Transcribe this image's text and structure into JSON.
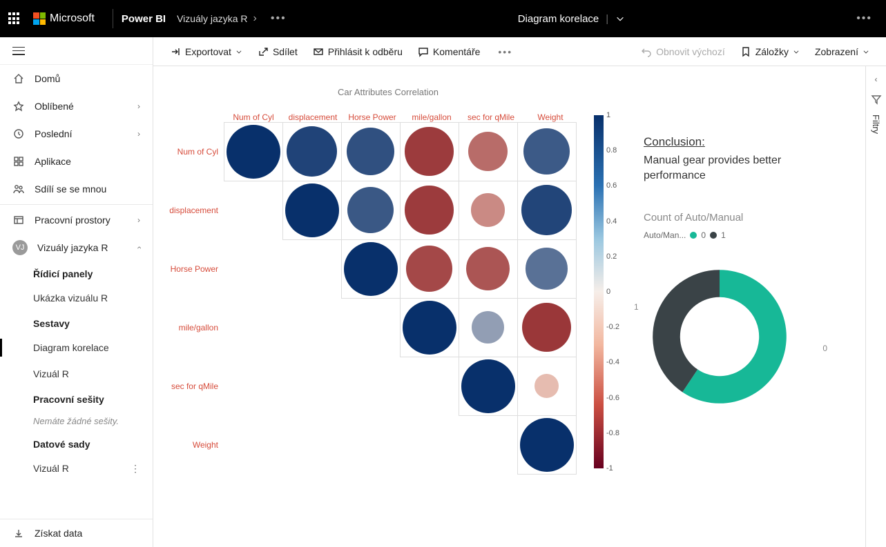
{
  "header": {
    "brand": "Microsoft",
    "app": "Power BI",
    "breadcrumb": "Vizuály jazyka R",
    "page_title": "Diagram korelace"
  },
  "nav": {
    "home": "Domů",
    "favorites": "Oblíbené",
    "recent": "Poslední",
    "apps": "Aplikace",
    "shared": "Sdílí se se mnou",
    "workspaces": "Pracovní prostory",
    "current_ws": "Vizuály jazyka R",
    "ws_initials": "VJ",
    "sections": {
      "dashboards": "Řídicí panely",
      "dash_item1": "Ukázka vizuálu R",
      "reports": "Sestavy",
      "rep_item1": "Diagram korelace",
      "rep_item2": "Vizuál R",
      "workbooks": "Pracovní sešity",
      "workbooks_empty": "Nemáte žádné sešity.",
      "datasets": "Datové sady",
      "ds_item1": "Vizuál R"
    },
    "get_data": "Získat data"
  },
  "toolbar": {
    "export": "Exportovat",
    "share": "Sdílet",
    "subscribe": "Přihlásit k odběru",
    "comments": "Komentáře",
    "reset": "Obnovit výchozí",
    "bookmarks": "Záložky",
    "view": "Zobrazení"
  },
  "filters_rail": "Filtry",
  "report": {
    "chart_title": "Car Attributes Correlation",
    "conclusion_head": "Conclusion:",
    "conclusion_text": "Manual gear provides better performance",
    "donut_title": "Count of Auto/Manual",
    "donut_legend_label": "Auto/Man...",
    "donut_legend_0": "0",
    "donut_legend_1": "1",
    "donut_callout_0": "0",
    "donut_callout_1": "1"
  },
  "chart_data": [
    {
      "type": "heatmap",
      "title": "Car Attributes Correlation",
      "variables": [
        "Num of Cyl",
        "displacement",
        "Horse Power",
        "mile/gallon",
        "sec for qMile",
        "Weight"
      ],
      "matrix": [
        [
          1.0,
          0.9,
          0.83,
          -0.85,
          -0.59,
          0.78
        ],
        [
          null,
          1.0,
          0.79,
          -0.85,
          -0.43,
          0.89
        ],
        [
          null,
          null,
          1.0,
          -0.78,
          -0.71,
          0.66
        ],
        [
          null,
          null,
          null,
          1.0,
          0.42,
          -0.87
        ],
        [
          null,
          null,
          null,
          null,
          1.0,
          -0.17
        ],
        [
          null,
          null,
          null,
          null,
          null,
          1.0
        ]
      ],
      "colorbar": {
        "min": -1,
        "max": 1,
        "ticks": [
          1,
          0.8,
          0.6,
          0.4,
          0.2,
          0,
          -0.2,
          -0.4,
          -0.6,
          -0.8,
          -1
        ]
      }
    },
    {
      "type": "pie",
      "title": "Count of Auto/Manual",
      "series": [
        {
          "name": "0",
          "value": 19,
          "color": "#17b897"
        },
        {
          "name": "1",
          "value": 13,
          "color": "#3a4347"
        }
      ]
    }
  ]
}
